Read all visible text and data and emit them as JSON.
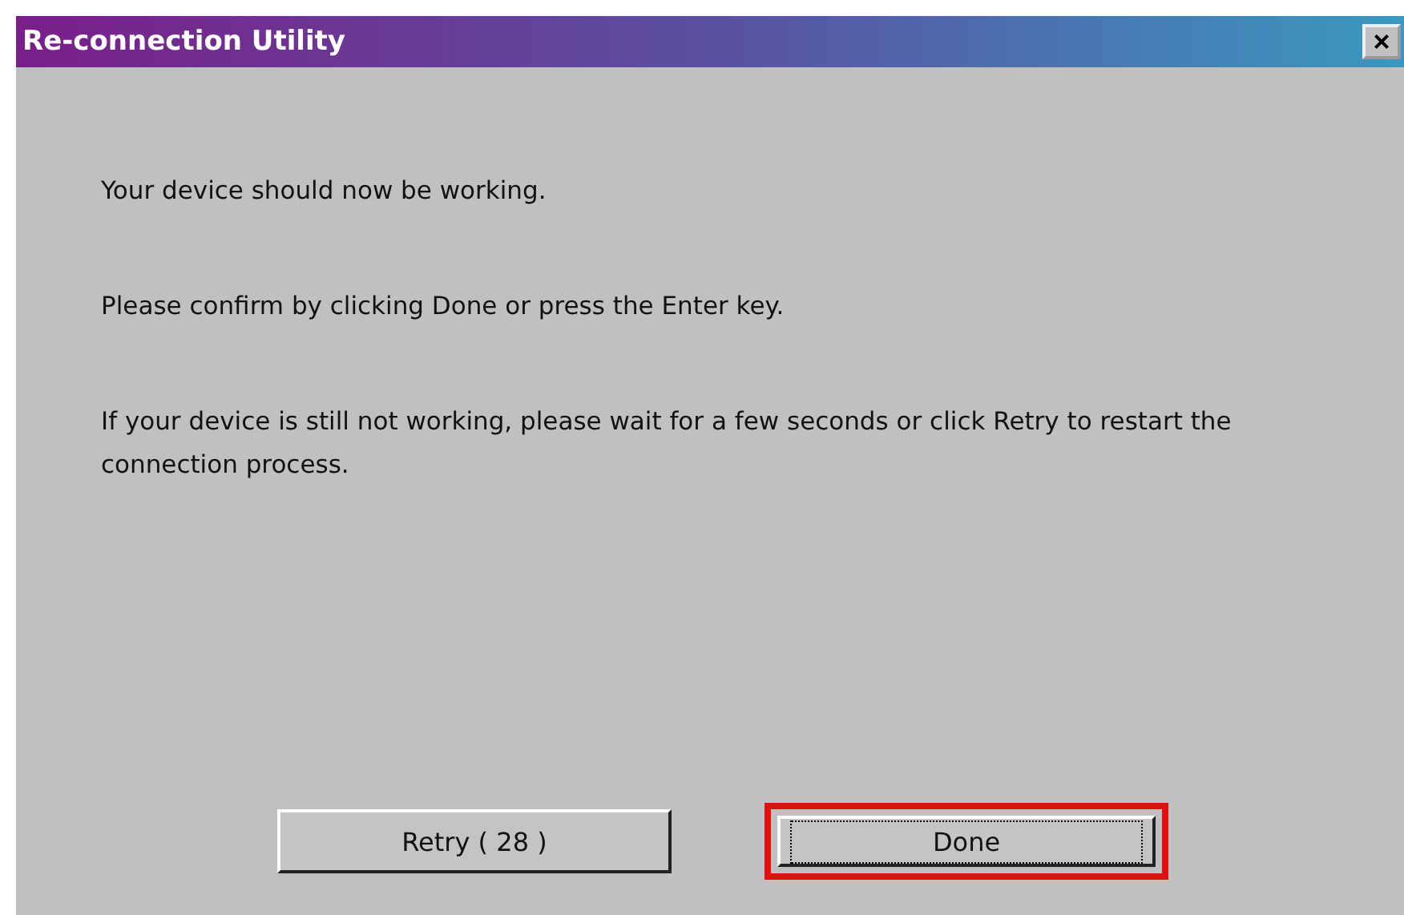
{
  "window": {
    "title": "Re-connection Utility",
    "close": "×"
  },
  "messages": [
    "Your device should now be working.",
    "Please confirm by clicking Done or press the Enter key.",
    "If your device is still not working, please wait for a few seconds or click Retry to restart the connection process."
  ],
  "buttons": [
    {
      "label": "Retry  ( 28 )",
      "focused": false,
      "highlighted": false
    },
    {
      "label": "Done",
      "focused": true,
      "highlighted": true
    }
  ]
}
